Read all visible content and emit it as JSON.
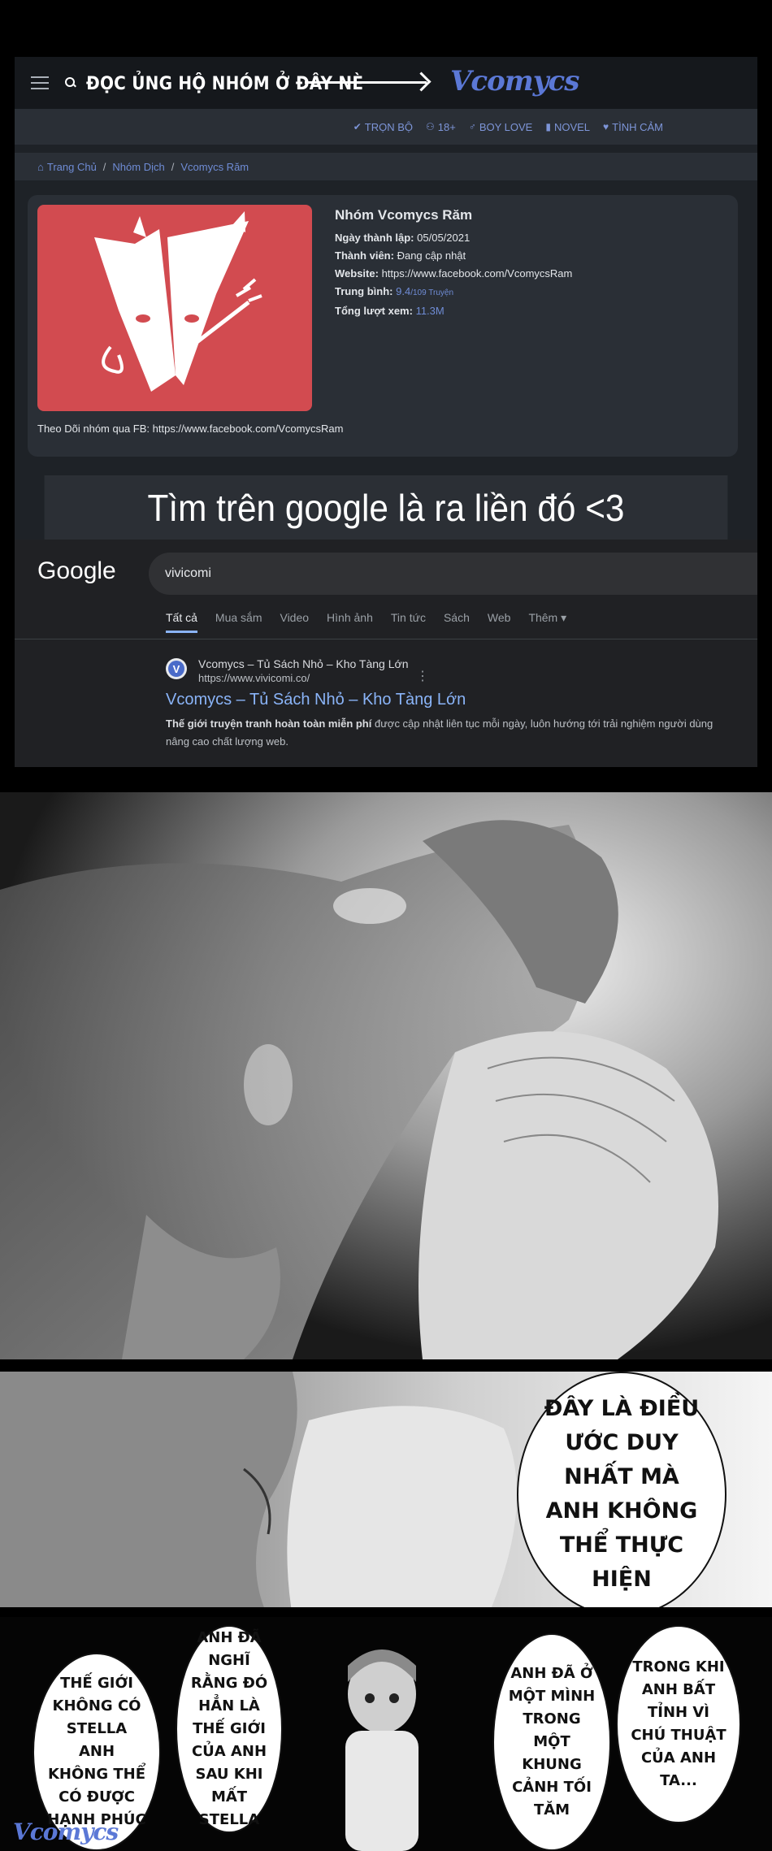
{
  "header": {
    "promo_text": "ĐỌC ỦNG HỘ NHÓM Ở ĐÂY NÈ",
    "logo_text": "Vcomycs"
  },
  "nav": [
    {
      "icon": "check-icon",
      "label": "TRỌN BỘ"
    },
    {
      "icon": "people-icon",
      "label": "18+"
    },
    {
      "icon": "male-icon",
      "label": "BOY LOVE"
    },
    {
      "icon": "book-icon",
      "label": "NOVEL"
    },
    {
      "icon": "heart-icon",
      "label": "TÌNH CẢM"
    }
  ],
  "breadcrumb": {
    "home": "Trang Chủ",
    "groups": "Nhóm Dịch",
    "current": "Vcomycs Răm"
  },
  "group": {
    "name": "Nhóm Vcomycs Răm",
    "founded_label": "Ngày thành lập:",
    "founded": "05/05/2021",
    "members_label": "Thành viên:",
    "members": "Đang cập nhật",
    "website_label": "Website:",
    "website": "https://www.facebook.com/VcomycsRam",
    "avg_label": "Trung bình:",
    "avg": "9.4",
    "avg_small": "/109 Truyện",
    "views_label": "Tổng lượt xem:",
    "views": "11.3M",
    "follow": "Theo Dõi nhóm qua FB: https://www.facebook.com/VcomycsRam"
  },
  "banner": "Tìm trên google là ra liền đó <3",
  "google": {
    "logo": "Google",
    "query": "vivicomi",
    "tabs": [
      "Tất cả",
      "Mua sắm",
      "Video",
      "Hình ảnh",
      "Tin tức",
      "Sách",
      "Web",
      "Thêm ▾"
    ],
    "result_site": "Vcomycs – Tủ Sách Nhỏ – Kho Tàng Lớn",
    "result_url": "https://www.vivicomi.co/",
    "result_title": "Vcomycs – Tủ Sách Nhỏ – Kho Tàng Lớn",
    "result_desc_bold": "Thế giới truyện tranh hoàn toàn miễn phí",
    "result_desc": " được cập nhật liên tục mỗi ngày, luôn hướng tới trải nghiệm người dùng nâng cao chất lượng web."
  },
  "bubbles": {
    "b1": "ĐÂY LÀ ĐIỀU ƯỚC DUY NHẤT MÀ ANH KHÔNG THỂ THỰC HIỆN",
    "b2": "THẾ GIỚI KHÔNG CÓ STELLA ANH KHÔNG THỂ CÓ ĐƯỢC HẠNH PHÚC",
    "b3": "ANH ĐÃ NGHĨ RẰNG ĐÓ HẲN LÀ THẾ GIỚI CỦA ANH SAU KHI MẤT STELLA",
    "b4": "ANH ĐÃ Ở MỘT MÌNH TRONG MỘT KHUNG CẢNH TỐI TĂM",
    "b5": "TRONG KHI ANH BẤT TỈNH VÌ CHÚ THUẬT CỦA ANH TA..."
  },
  "watermark": "Vcomycs"
}
